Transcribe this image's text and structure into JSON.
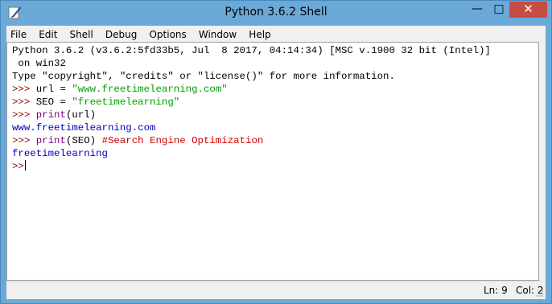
{
  "window": {
    "title": "Python 3.6.2 Shell"
  },
  "titlebar": {
    "min_glyph": "—",
    "max_glyph": "□",
    "close_glyph": "✕"
  },
  "menu": [
    "File",
    "Edit",
    "Shell",
    "Debug",
    "Options",
    "Window",
    "Help"
  ],
  "shell": {
    "banner1": "Python 3.6.2 (v3.6.2:5fd33b5, Jul  8 2017, 04:14:34) [MSC v.1900 32 bit (Intel)]",
    "banner2": " on win32",
    "banner3": "Type \"copyright\", \"credits\" or \"license()\" for more information.",
    "prompt": ">>> ",
    "l1_code": "url = ",
    "l1_str": "\"www.freetimelearning.com\"",
    "l2_code": "SEO = ",
    "l2_str": "\"freetimelearning\"",
    "l3_fn": "print",
    "l3_args": "(url)",
    "out1": "www.freetimelearning.com",
    "l4_fn": "print",
    "l4_args": "(SEO) ",
    "l4_comment": "#Search Engine Optimization",
    "out2": "freetimelearning",
    "final_prompt": ">>"
  },
  "status": {
    "line": "Ln: 9",
    "col": "Col: 2"
  },
  "colors": {
    "titlebar": "#6ba9d8",
    "close": "#c74d44",
    "prompt": "#8b0000",
    "string": "#00a000",
    "builtin": "#800080",
    "comment": "#d00000",
    "output": "#0000c0"
  }
}
